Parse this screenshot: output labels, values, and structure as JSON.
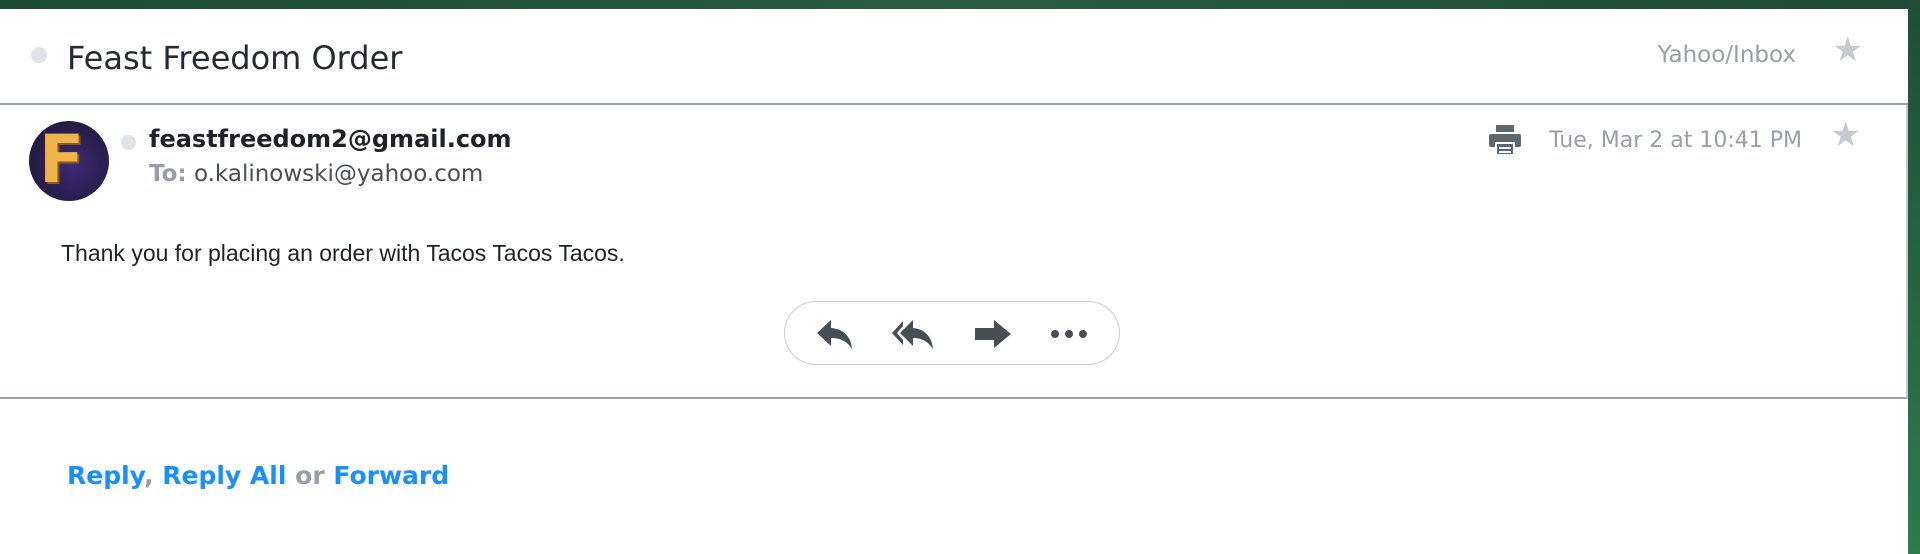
{
  "header": {
    "subject": "Feast Freedom Order",
    "folder": "Yahoo/Inbox",
    "star_icon": "star-icon"
  },
  "message": {
    "sender": "feastfreedom2@gmail.com",
    "to_label": "To:",
    "to_address": "o.kalinowski@yahoo.com",
    "date": "Tue, Mar 2 at 10:41 PM",
    "avatar_letter": "F",
    "body": "Thank you for placing an order with Tacos Tacos Tacos.",
    "actions": [
      "reply-icon",
      "reply-all-icon",
      "forward-icon",
      "more-icon"
    ]
  },
  "footer": {
    "reply": "Reply",
    "comma": ",",
    "reply_all": "Reply All",
    "or": "or",
    "forward": "Forward"
  },
  "colors": {
    "link": "#188fff",
    "muted": "#979ea8",
    "icon": "#464e56"
  }
}
